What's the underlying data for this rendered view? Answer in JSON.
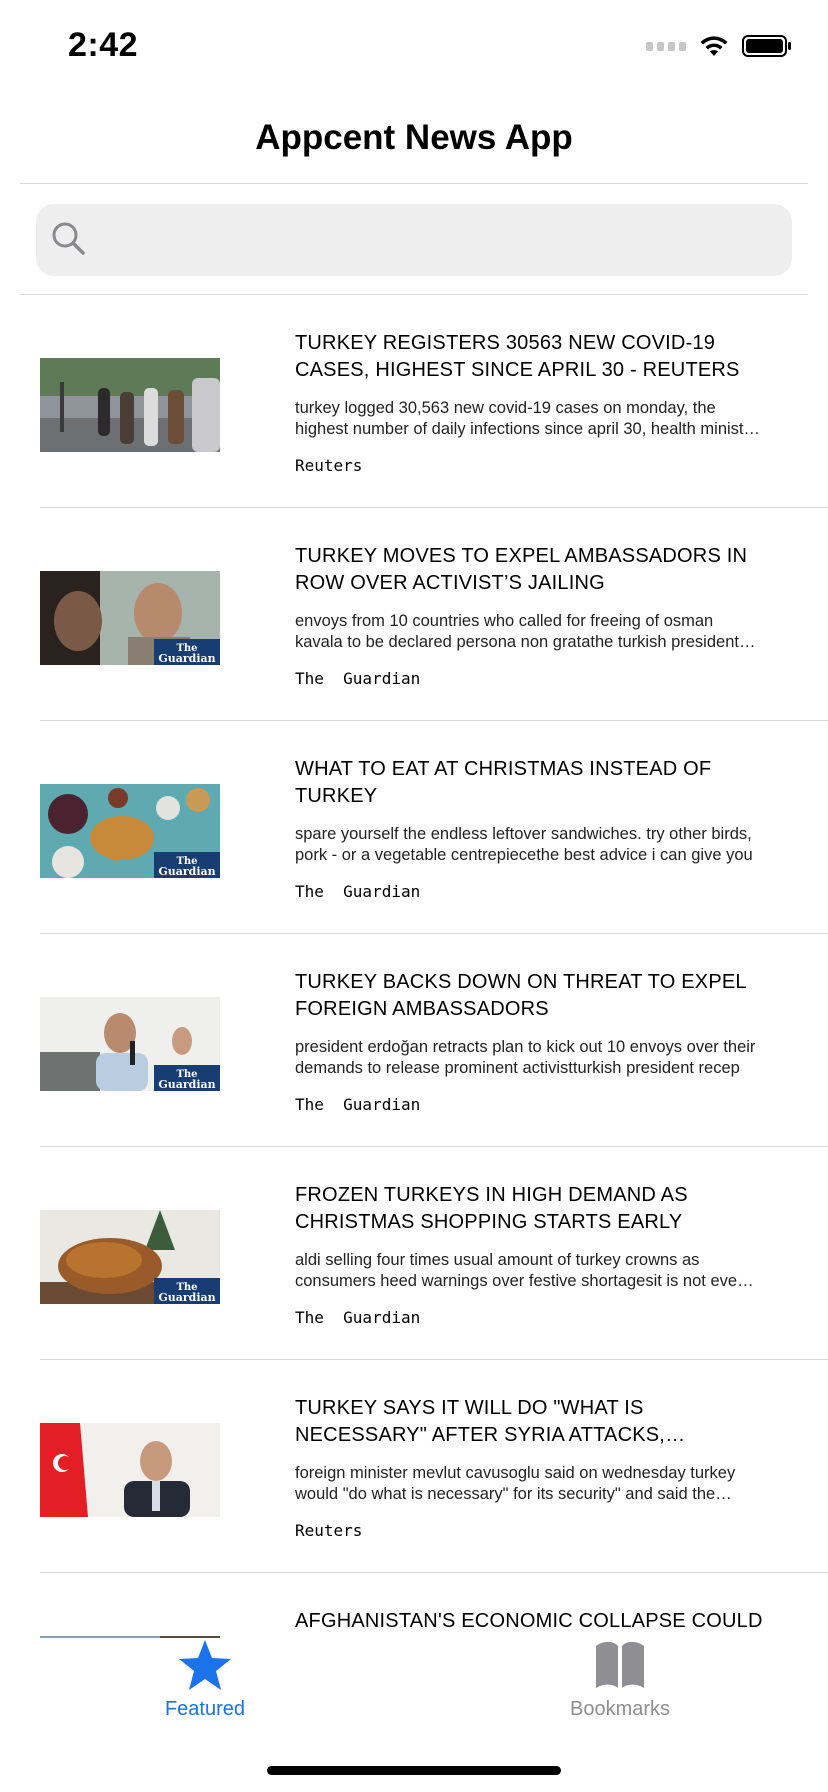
{
  "status_bar": {
    "time": "2:42"
  },
  "header": {
    "title": "Appcent News App"
  },
  "search": {
    "placeholder": "",
    "value": ""
  },
  "articles": [
    {
      "title": "Turkey registers 30563 new COVID-19 cases, highest since April 30 - Reuters",
      "description": "turkey logged 30,563 new covid-19 cases on monday, the highest number of daily infections since april 30, health ministry data showed.",
      "source": "Reuters",
      "thumbnail": "street-crowd-photo"
    },
    {
      "title": "Turkey moves to expel ambassadors in row over activist’s jailing",
      "description": "envoys from 10 countries who called for freeing of osman kavala to be declared persona non gratathe turkish president has ordered",
      "source": "The  Guardian",
      "thumbnail": "osman-kavala-photo"
    },
    {
      "title": "What to eat at Christmas instead of turkey",
      "description": "spare yourself the endless leftover sandwiches. try other birds, pork - or a vegetable centrepiecethe best advice i can give you",
      "source": "The  Guardian",
      "thumbnail": "christmas-food-photo"
    },
    {
      "title": "Turkey backs down on threat to expel foreign ambassadors",
      "description": "president erdoğan retracts plan to kick out 10 envoys over their demands to release prominent activistturkish president recep",
      "source": "The  Guardian",
      "thumbnail": "speaker-microphone-photo"
    },
    {
      "title": "Frozen turkeys in high demand as Christmas shopping starts early",
      "description": "aldi selling four times usual amount of turkey crowns as consumers heed warnings over festive shortagesit is not even december",
      "source": "The  Guardian",
      "thumbnail": "roast-turkey-photo"
    },
    {
      "title": "Turkey says it will do \"what is necessary\" after Syria attacks, criticises US",
      "description": "foreign minister mevlut cavusoglu said on wednesday turkey would \"do what is necessary\" for its security\" and said the united states",
      "source": "Reuters",
      "thumbnail": "minister-flag-photo"
    },
    {
      "title": "Afghanistan's economic collapse could",
      "description": "",
      "source": "",
      "thumbnail": "partial-photo"
    }
  ],
  "tab_bar": {
    "featured": {
      "label": "Featured",
      "icon": "star-icon",
      "active": true
    },
    "bookmarks": {
      "label": "Bookmarks",
      "icon": "book-icon",
      "active": false
    }
  },
  "colors": {
    "accent": "#1a73e8",
    "inactive": "#8e8e93",
    "divider": "#d8d8d8",
    "search_bg": "#eeeeef"
  }
}
